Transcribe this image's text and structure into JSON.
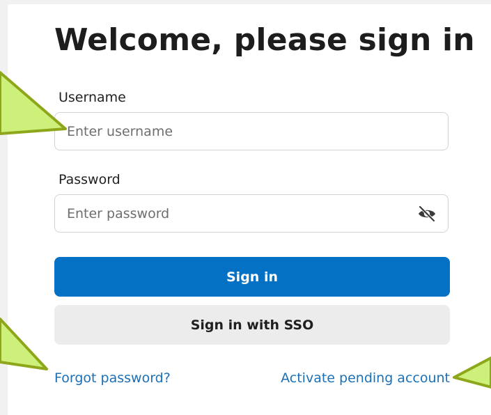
{
  "form": {
    "title": "Welcome, please sign in",
    "username": {
      "label": "Username",
      "placeholder": "Enter username",
      "value": ""
    },
    "password": {
      "label": "Password",
      "placeholder": "Enter password",
      "value": "",
      "toggle_icon": "eye-slash-icon"
    },
    "sign_in_label": "Sign in",
    "sso_label": "Sign in with SSO",
    "forgot_password_label": "Forgot password?",
    "activate_account_label": "Activate pending account"
  },
  "colors": {
    "primary_button": "#0571c4",
    "secondary_button": "#ececec",
    "link": "#1a6fb6",
    "callout_fill": "#ccf07a",
    "callout_stroke": "#8ea61a"
  }
}
